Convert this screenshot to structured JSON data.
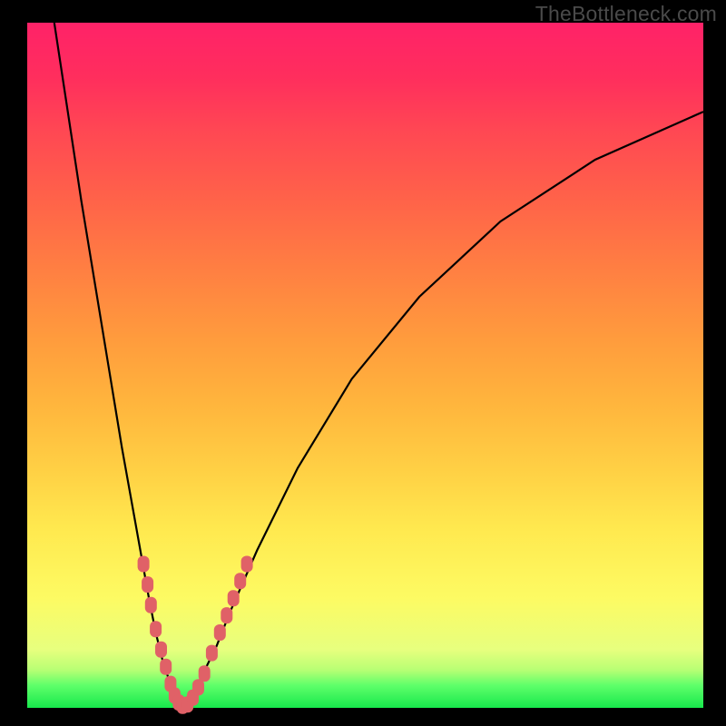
{
  "watermark": "TheBottleneck.com",
  "colors": {
    "frame": "#000000",
    "gradient_top": "#ff2268",
    "gradient_mid": "#ffd93d",
    "gradient_bottom": "#17e84c",
    "curve": "#000000",
    "markers": "#e06167"
  },
  "chart_data": {
    "type": "line",
    "title": "",
    "xlabel": "",
    "ylabel": "",
    "xlim": [
      0,
      100
    ],
    "ylim": [
      0,
      100
    ],
    "grid": false,
    "legend": false,
    "series": [
      {
        "name": "left-v-curve",
        "x": [
          4,
          6,
          8,
          10,
          12,
          14,
          16,
          18,
          19,
          20,
          21,
          22,
          23
        ],
        "y": [
          100,
          87,
          74,
          62,
          50,
          38,
          27,
          16,
          11,
          7,
          4,
          1.5,
          0
        ]
      },
      {
        "name": "right-v-curve",
        "x": [
          23,
          24,
          25,
          26,
          28,
          30,
          34,
          40,
          48,
          58,
          70,
          84,
          100
        ],
        "y": [
          0,
          1,
          3,
          5,
          9,
          14,
          23,
          35,
          48,
          60,
          71,
          80,
          87
        ]
      }
    ],
    "markers": {
      "name": "highlighted-points",
      "shape": "rounded-rect",
      "color": "#e06167",
      "points": [
        {
          "x": 17.2,
          "y": 21
        },
        {
          "x": 17.8,
          "y": 18
        },
        {
          "x": 18.3,
          "y": 15
        },
        {
          "x": 19.0,
          "y": 11.5
        },
        {
          "x": 19.8,
          "y": 8.5
        },
        {
          "x": 20.5,
          "y": 6
        },
        {
          "x": 21.2,
          "y": 3.5
        },
        {
          "x": 21.8,
          "y": 1.8
        },
        {
          "x": 22.4,
          "y": 0.8
        },
        {
          "x": 23.0,
          "y": 0.3
        },
        {
          "x": 23.7,
          "y": 0.5
        },
        {
          "x": 24.5,
          "y": 1.5
        },
        {
          "x": 25.3,
          "y": 3
        },
        {
          "x": 26.2,
          "y": 5
        },
        {
          "x": 27.3,
          "y": 8
        },
        {
          "x": 28.5,
          "y": 11
        },
        {
          "x": 29.5,
          "y": 13.5
        },
        {
          "x": 30.5,
          "y": 16
        },
        {
          "x": 31.5,
          "y": 18.5
        },
        {
          "x": 32.5,
          "y": 21
        }
      ]
    }
  }
}
